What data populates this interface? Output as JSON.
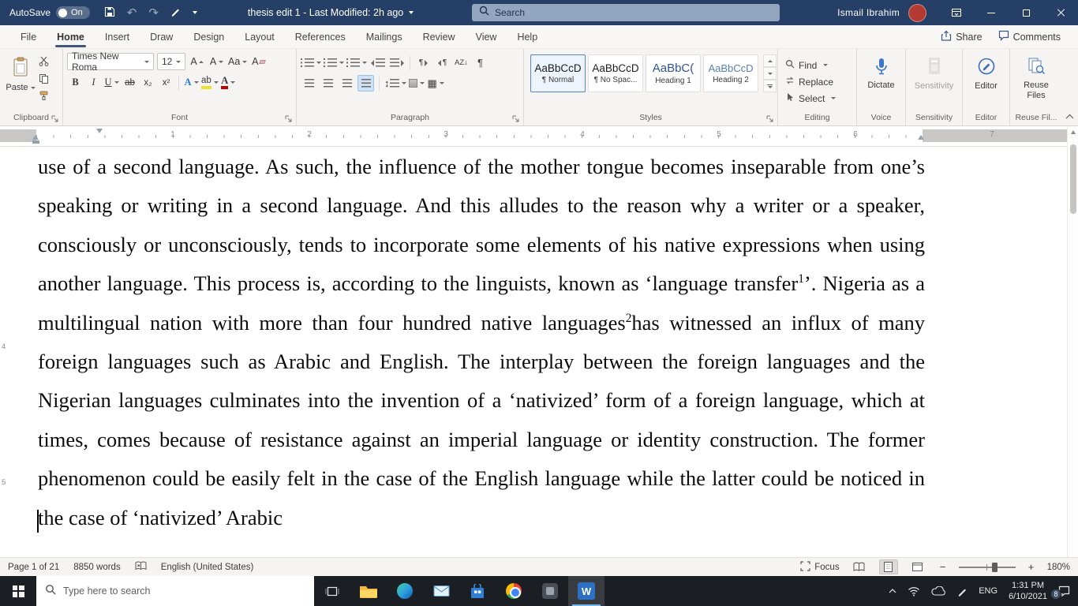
{
  "titlebar": {
    "autosave_label": "AutoSave",
    "autosave_state": "On",
    "doc_title": "thesis edit 1  -  Last Modified: 2h ago",
    "search_placeholder": "Search",
    "user_name": "Ismail Ibrahim"
  },
  "tabs": [
    "File",
    "Home",
    "Insert",
    "Draw",
    "Design",
    "Layout",
    "References",
    "Mailings",
    "Review",
    "View",
    "Help"
  ],
  "active_tab": "Home",
  "collab": {
    "share": "Share",
    "comments": "Comments"
  },
  "icons": {
    "undo": "↶",
    "redo": "↷",
    "pilcrow": "¶",
    "sort": "AZ↓",
    "updown": "↕",
    "borders": "▦",
    "minus": "−",
    "plus": "+",
    "word_logo": "W"
  },
  "ribbon": {
    "clipboard": {
      "paste": "Paste",
      "group_label": "Clipboard"
    },
    "font": {
      "family": "Times New Roma",
      "size": "12",
      "grow": "A",
      "shrink": "A",
      "case": "Aa",
      "clear": "A",
      "bold": "B",
      "italic": "I",
      "underline": "U",
      "strike": "ab",
      "sub": "x₂",
      "sup": "x²",
      "effects": "A",
      "highlight": "ab",
      "color": "A",
      "group_label": "Font"
    },
    "paragraph": {
      "group_label": "Paragraph"
    },
    "styles": {
      "items": [
        {
          "sample": "AaBbCcD",
          "label": "¶ Normal"
        },
        {
          "sample": "AaBbCcD",
          "label": "¶ No Spac..."
        },
        {
          "sample": "AaBbC(",
          "label": "Heading 1"
        },
        {
          "sample": "AaBbCcD",
          "label": "Heading 2"
        }
      ],
      "group_label": "Styles"
    },
    "editing": {
      "find": "Find",
      "replace": "Replace",
      "select": "Select",
      "group_label": "Editing"
    },
    "voice": {
      "dictate": "Dictate",
      "group_label": "Voice"
    },
    "sensitivity": {
      "button": "Sensitivity",
      "group_label": "Sensitivity"
    },
    "editor": {
      "button": "Editor",
      "group_label": "Editor"
    },
    "reuse": {
      "button_line1": "Reuse",
      "button_line2": "Files",
      "group_label": "Reuse Fil..."
    }
  },
  "ruler": {
    "h": [
      "1",
      "2",
      "3",
      "4",
      "5",
      "6",
      "7"
    ],
    "v": [
      "4",
      "5"
    ]
  },
  "document": {
    "segments": [
      {
        "t": "use of a second language. As such, the influence of the mother tongue becomes inseparable from one’s speaking or writing in a second language. And this alludes to the reason why a writer or a speaker, consciously or unconsciously, tends to incorporate some elements of his native expressions when using another language. This process is, according to the linguists, known as ‘language transfer"
      },
      {
        "t": "1",
        "sup": true
      },
      {
        "t": "’. Nigeria as a multilingual nation with more than four hundred native languages"
      },
      {
        "t": "2",
        "sup": true
      },
      {
        "t": "has witnessed an influx of many foreign languages such as Arabic and English. The interplay between the foreign languages and the Nigerian languages culminates into the invention of a ‘nativized’ form of a foreign language, which at times, comes because of resistance against an imperial language or identity construction. The former phenomenon could be easily felt in the case of the English language while the latter could be noticed in the case of ‘nativized’ Arabic"
      }
    ]
  },
  "statusbar": {
    "page": "Page 1 of 21",
    "words": "8850 words",
    "language": "English (United States)",
    "focus": "Focus",
    "zoom": "180%"
  },
  "taskbar": {
    "search_placeholder": "Type here to search",
    "lang": "ENG",
    "time": "1:31 PM",
    "date": "6/10/2021",
    "badge": "8"
  }
}
